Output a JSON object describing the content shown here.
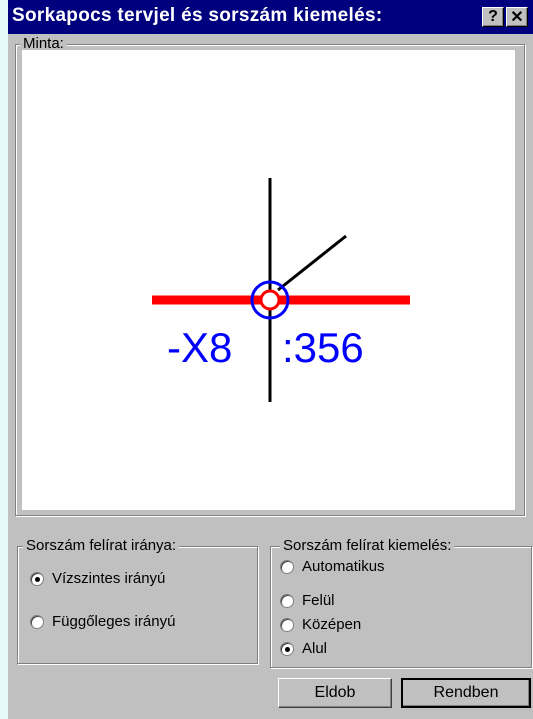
{
  "window": {
    "title": "Sorkapocs tervjel és sorszám kiemelés:",
    "help_label": "?",
    "close_label": "✕"
  },
  "preview_group": {
    "label": "Minta:",
    "designator": "-X8",
    "terminal_number": ":356",
    "colors": {
      "line": "#ff0000",
      "text": "#0000ff",
      "circle": "#0000ff"
    }
  },
  "direction_group": {
    "label": "Sorszám felírat iránya:",
    "options": [
      {
        "label": "Vízszintes irányú",
        "checked": true
      },
      {
        "label": "Függőleges irányú",
        "checked": false
      }
    ]
  },
  "highlight_group": {
    "label": "Sorszám felírat kiemelés:",
    "options": [
      {
        "label": "Automatikus",
        "checked": false
      },
      {
        "label": "Felül",
        "checked": false
      },
      {
        "label": "Középen",
        "checked": false
      },
      {
        "label": "Alul",
        "checked": true
      }
    ]
  },
  "buttons": {
    "cancel": "Eldob",
    "ok": "Rendben"
  }
}
